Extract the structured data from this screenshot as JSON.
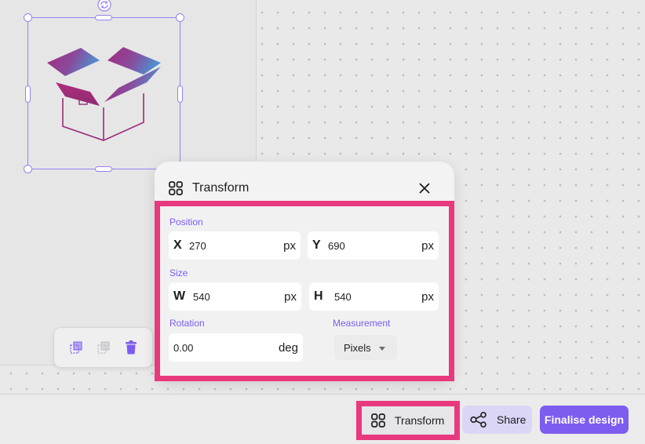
{
  "canvas": {
    "graphic": "open-box-icon"
  },
  "element_toolbar": {
    "icons": [
      "layers-icon",
      "duplicate-icon",
      "trash-icon"
    ]
  },
  "transform_panel": {
    "title": "Transform",
    "position": {
      "label": "Position",
      "x": {
        "prefix": "X",
        "value": "270",
        "unit": "px"
      },
      "y": {
        "prefix": "Y",
        "value": "690",
        "unit": "px"
      }
    },
    "size": {
      "label": "Size",
      "w": {
        "prefix": "W",
        "value": "540",
        "unit": "px"
      },
      "h": {
        "prefix": "H",
        "value": "540",
        "unit": "px"
      }
    },
    "rotation": {
      "label": "Rotation",
      "value": "0.00",
      "unit": "deg"
    },
    "measurement": {
      "label": "Measurement",
      "selected": "Pixels"
    }
  },
  "bottom_bar": {
    "transform_label": "Transform",
    "share_label": "Share",
    "finalise_label": "Finalise design"
  },
  "colors": {
    "accent": "#7d5cf0",
    "highlight": "#e8397e",
    "selection": "#9a7ff0"
  }
}
